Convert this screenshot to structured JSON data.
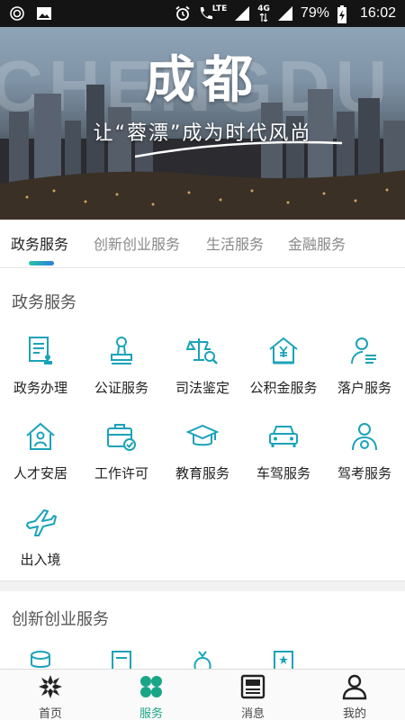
{
  "status_bar": {
    "network_small_top": "LTE",
    "network_label": "4G",
    "battery": "79%",
    "time": "16:02"
  },
  "banner": {
    "title": "成都",
    "subtitle": "让“蓉漂”成为时代风尚",
    "bg_letters": "CHENGDU"
  },
  "tabs": [
    {
      "label": "政务服务",
      "active": true
    },
    {
      "label": "创新创业服务",
      "active": false
    },
    {
      "label": "生活服务",
      "active": false
    },
    {
      "label": "金融服务",
      "active": false
    }
  ],
  "sections": [
    {
      "title": "政务服务",
      "items": [
        {
          "label": "政务办理",
          "icon": "document-stamp-icon"
        },
        {
          "label": "公证服务",
          "icon": "seal-stamp-icon"
        },
        {
          "label": "司法鉴定",
          "icon": "scales-search-icon"
        },
        {
          "label": "公积金服务",
          "icon": "house-yuan-icon"
        },
        {
          "label": "落户服务",
          "icon": "person-card-icon"
        },
        {
          "label": "人才安居",
          "icon": "home-person-icon"
        },
        {
          "label": "工作许可",
          "icon": "briefcase-check-icon"
        },
        {
          "label": "教育服务",
          "icon": "graduation-cap-icon"
        },
        {
          "label": "车驾服务",
          "icon": "car-icon"
        },
        {
          "label": "驾考服务",
          "icon": "driver-person-icon"
        },
        {
          "label": "出入境",
          "icon": "airplane-icon"
        }
      ]
    },
    {
      "title": "创新创业服务",
      "items": [
        {
          "label": "",
          "icon": "coins-icon"
        },
        {
          "label": "",
          "icon": "certificate-icon"
        },
        {
          "label": "",
          "icon": "money-bag-icon"
        },
        {
          "label": "",
          "icon": "badge-star-icon"
        }
      ]
    }
  ],
  "bottom_nav": [
    {
      "label": "首页",
      "icon": "home-logo-icon",
      "active": false
    },
    {
      "label": "服务",
      "icon": "clover-grid-icon",
      "active": true
    },
    {
      "label": "消息",
      "icon": "news-icon",
      "active": false
    },
    {
      "label": "我的",
      "icon": "user-icon",
      "active": false
    }
  ],
  "colors": {
    "accent": "#1aa587",
    "icon": "#1aa3b8",
    "tab_indicator_start": "#26c6a6",
    "tab_indicator_end": "#2f7be0"
  }
}
